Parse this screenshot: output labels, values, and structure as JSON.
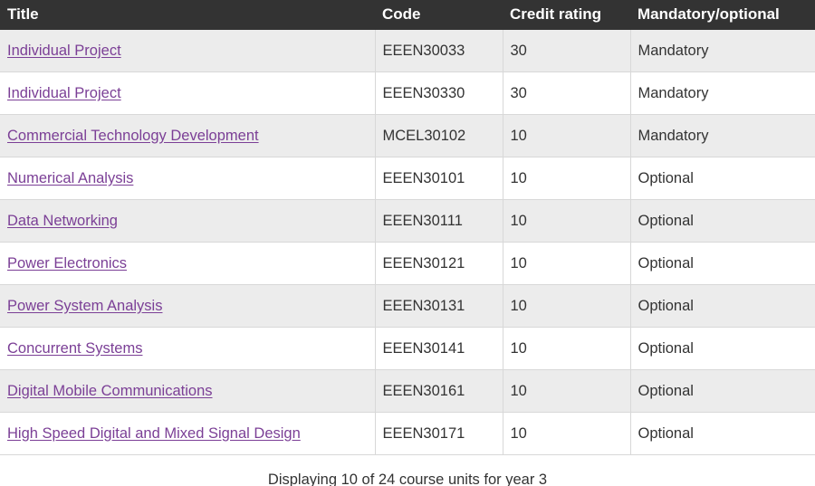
{
  "table": {
    "columns": [
      {
        "key": "title",
        "label": "Title"
      },
      {
        "key": "code",
        "label": "Code"
      },
      {
        "key": "credit",
        "label": "Credit rating"
      },
      {
        "key": "mand",
        "label": "Mandatory/optional"
      }
    ],
    "rows": [
      {
        "title": "Individual Project",
        "code": "EEEN30033",
        "credit": "30",
        "mand": "Mandatory"
      },
      {
        "title": "Individual Project",
        "code": "EEEN30330",
        "credit": "30",
        "mand": "Mandatory"
      },
      {
        "title": "Commercial Technology Development",
        "code": "MCEL30102",
        "credit": "10",
        "mand": "Mandatory"
      },
      {
        "title": "Numerical Analysis",
        "code": "EEEN30101",
        "credit": "10",
        "mand": "Optional"
      },
      {
        "title": "Data Networking",
        "code": "EEEN30111",
        "credit": "10",
        "mand": "Optional"
      },
      {
        "title": "Power Electronics",
        "code": "EEEN30121",
        "credit": "10",
        "mand": "Optional"
      },
      {
        "title": "Power System Analysis",
        "code": "EEEN30131",
        "credit": "10",
        "mand": "Optional"
      },
      {
        "title": "Concurrent Systems",
        "code": "EEEN30141",
        "credit": "10",
        "mand": "Optional"
      },
      {
        "title": "Digital Mobile Communications",
        "code": "EEEN30161",
        "credit": "10",
        "mand": "Optional"
      },
      {
        "title": "High Speed Digital and Mixed Signal Design",
        "code": "EEEN30171",
        "credit": "10",
        "mand": "Optional"
      }
    ],
    "caption": "Displaying 10 of 24 course units for year 3"
  },
  "colors": {
    "header_background": "#333333",
    "header_text": "#ffffff",
    "row_stripe": "#ececec",
    "row_plain": "#ffffff",
    "link": "#7b3f96",
    "body_text": "#333333",
    "border": "#d8d8d8"
  }
}
